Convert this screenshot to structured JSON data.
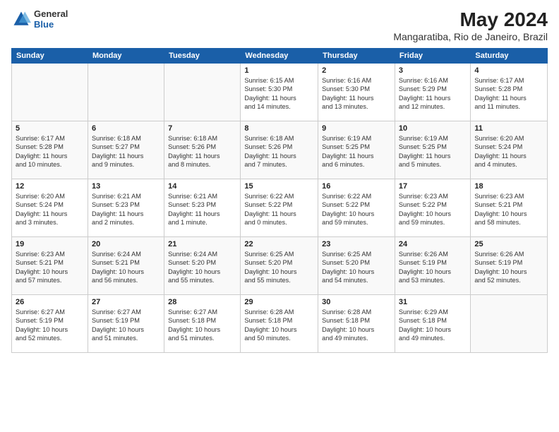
{
  "header": {
    "logo_general": "General",
    "logo_blue": "Blue",
    "title": "May 2024",
    "location": "Mangaratiba, Rio de Janeiro, Brazil"
  },
  "weekdays": [
    "Sunday",
    "Monday",
    "Tuesday",
    "Wednesday",
    "Thursday",
    "Friday",
    "Saturday"
  ],
  "weeks": [
    [
      {
        "day": "",
        "info": ""
      },
      {
        "day": "",
        "info": ""
      },
      {
        "day": "",
        "info": ""
      },
      {
        "day": "1",
        "info": "Sunrise: 6:15 AM\nSunset: 5:30 PM\nDaylight: 11 hours\nand 14 minutes."
      },
      {
        "day": "2",
        "info": "Sunrise: 6:16 AM\nSunset: 5:30 PM\nDaylight: 11 hours\nand 13 minutes."
      },
      {
        "day": "3",
        "info": "Sunrise: 6:16 AM\nSunset: 5:29 PM\nDaylight: 11 hours\nand 12 minutes."
      },
      {
        "day": "4",
        "info": "Sunrise: 6:17 AM\nSunset: 5:28 PM\nDaylight: 11 hours\nand 11 minutes."
      }
    ],
    [
      {
        "day": "5",
        "info": "Sunrise: 6:17 AM\nSunset: 5:28 PM\nDaylight: 11 hours\nand 10 minutes."
      },
      {
        "day": "6",
        "info": "Sunrise: 6:18 AM\nSunset: 5:27 PM\nDaylight: 11 hours\nand 9 minutes."
      },
      {
        "day": "7",
        "info": "Sunrise: 6:18 AM\nSunset: 5:26 PM\nDaylight: 11 hours\nand 8 minutes."
      },
      {
        "day": "8",
        "info": "Sunrise: 6:18 AM\nSunset: 5:26 PM\nDaylight: 11 hours\nand 7 minutes."
      },
      {
        "day": "9",
        "info": "Sunrise: 6:19 AM\nSunset: 5:25 PM\nDaylight: 11 hours\nand 6 minutes."
      },
      {
        "day": "10",
        "info": "Sunrise: 6:19 AM\nSunset: 5:25 PM\nDaylight: 11 hours\nand 5 minutes."
      },
      {
        "day": "11",
        "info": "Sunrise: 6:20 AM\nSunset: 5:24 PM\nDaylight: 11 hours\nand 4 minutes."
      }
    ],
    [
      {
        "day": "12",
        "info": "Sunrise: 6:20 AM\nSunset: 5:24 PM\nDaylight: 11 hours\nand 3 minutes."
      },
      {
        "day": "13",
        "info": "Sunrise: 6:21 AM\nSunset: 5:23 PM\nDaylight: 11 hours\nand 2 minutes."
      },
      {
        "day": "14",
        "info": "Sunrise: 6:21 AM\nSunset: 5:23 PM\nDaylight: 11 hours\nand 1 minute."
      },
      {
        "day": "15",
        "info": "Sunrise: 6:22 AM\nSunset: 5:22 PM\nDaylight: 11 hours\nand 0 minutes."
      },
      {
        "day": "16",
        "info": "Sunrise: 6:22 AM\nSunset: 5:22 PM\nDaylight: 10 hours\nand 59 minutes."
      },
      {
        "day": "17",
        "info": "Sunrise: 6:23 AM\nSunset: 5:22 PM\nDaylight: 10 hours\nand 59 minutes."
      },
      {
        "day": "18",
        "info": "Sunrise: 6:23 AM\nSunset: 5:21 PM\nDaylight: 10 hours\nand 58 minutes."
      }
    ],
    [
      {
        "day": "19",
        "info": "Sunrise: 6:23 AM\nSunset: 5:21 PM\nDaylight: 10 hours\nand 57 minutes."
      },
      {
        "day": "20",
        "info": "Sunrise: 6:24 AM\nSunset: 5:21 PM\nDaylight: 10 hours\nand 56 minutes."
      },
      {
        "day": "21",
        "info": "Sunrise: 6:24 AM\nSunset: 5:20 PM\nDaylight: 10 hours\nand 55 minutes."
      },
      {
        "day": "22",
        "info": "Sunrise: 6:25 AM\nSunset: 5:20 PM\nDaylight: 10 hours\nand 55 minutes."
      },
      {
        "day": "23",
        "info": "Sunrise: 6:25 AM\nSunset: 5:20 PM\nDaylight: 10 hours\nand 54 minutes."
      },
      {
        "day": "24",
        "info": "Sunrise: 6:26 AM\nSunset: 5:19 PM\nDaylight: 10 hours\nand 53 minutes."
      },
      {
        "day": "25",
        "info": "Sunrise: 6:26 AM\nSunset: 5:19 PM\nDaylight: 10 hours\nand 52 minutes."
      }
    ],
    [
      {
        "day": "26",
        "info": "Sunrise: 6:27 AM\nSunset: 5:19 PM\nDaylight: 10 hours\nand 52 minutes."
      },
      {
        "day": "27",
        "info": "Sunrise: 6:27 AM\nSunset: 5:19 PM\nDaylight: 10 hours\nand 51 minutes."
      },
      {
        "day": "28",
        "info": "Sunrise: 6:27 AM\nSunset: 5:18 PM\nDaylight: 10 hours\nand 51 minutes."
      },
      {
        "day": "29",
        "info": "Sunrise: 6:28 AM\nSunset: 5:18 PM\nDaylight: 10 hours\nand 50 minutes."
      },
      {
        "day": "30",
        "info": "Sunrise: 6:28 AM\nSunset: 5:18 PM\nDaylight: 10 hours\nand 49 minutes."
      },
      {
        "day": "31",
        "info": "Sunrise: 6:29 AM\nSunset: 5:18 PM\nDaylight: 10 hours\nand 49 minutes."
      },
      {
        "day": "",
        "info": ""
      }
    ]
  ]
}
